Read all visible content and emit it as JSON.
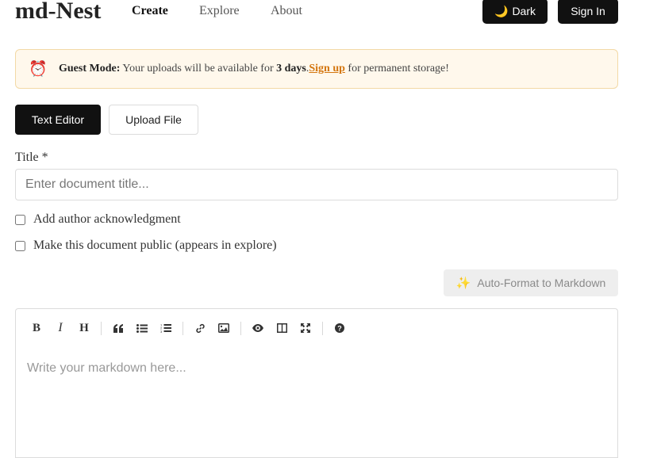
{
  "header": {
    "brand": "md-Nest",
    "nav": {
      "create": "Create",
      "explore": "Explore",
      "about": "About"
    },
    "dark_label": "Dark",
    "signin_label": "Sign In"
  },
  "banner": {
    "mode_label": "Guest Mode:",
    "text_before": " Your uploads will be available for ",
    "days": "3 days",
    "period": ".",
    "signup": "Sign up",
    "text_after": " for permanent storage!"
  },
  "tabs": {
    "text_editor": "Text Editor",
    "upload_file": "Upload File",
    "active": "text_editor"
  },
  "form": {
    "title_label": "Title *",
    "title_placeholder": "Enter document title...",
    "title_value": "",
    "ack_label": "Add author acknowledgment",
    "ack_checked": false,
    "public_label": "Make this document public (appears in explore)",
    "public_checked": false,
    "autoformat_label": "Auto-Format to Markdown"
  },
  "toolbar": {
    "bold": "B",
    "italic": "I",
    "heading": "H"
  },
  "editor": {
    "placeholder": "Write your markdown here...",
    "value": ""
  },
  "colors": {
    "primary": "#111111",
    "banner_bg": "#fff8ec",
    "banner_border": "#f3d9a6",
    "link": "#d4760e",
    "alarm": "#d4530f"
  },
  "icons": [
    "alarm-clock-icon",
    "moon-icon",
    "sparkles-icon",
    "quote-icon",
    "bullet-list-icon",
    "numbered-list-icon",
    "link-icon",
    "image-icon",
    "eye-icon",
    "side-by-side-icon",
    "fullscreen-icon",
    "help-icon"
  ]
}
